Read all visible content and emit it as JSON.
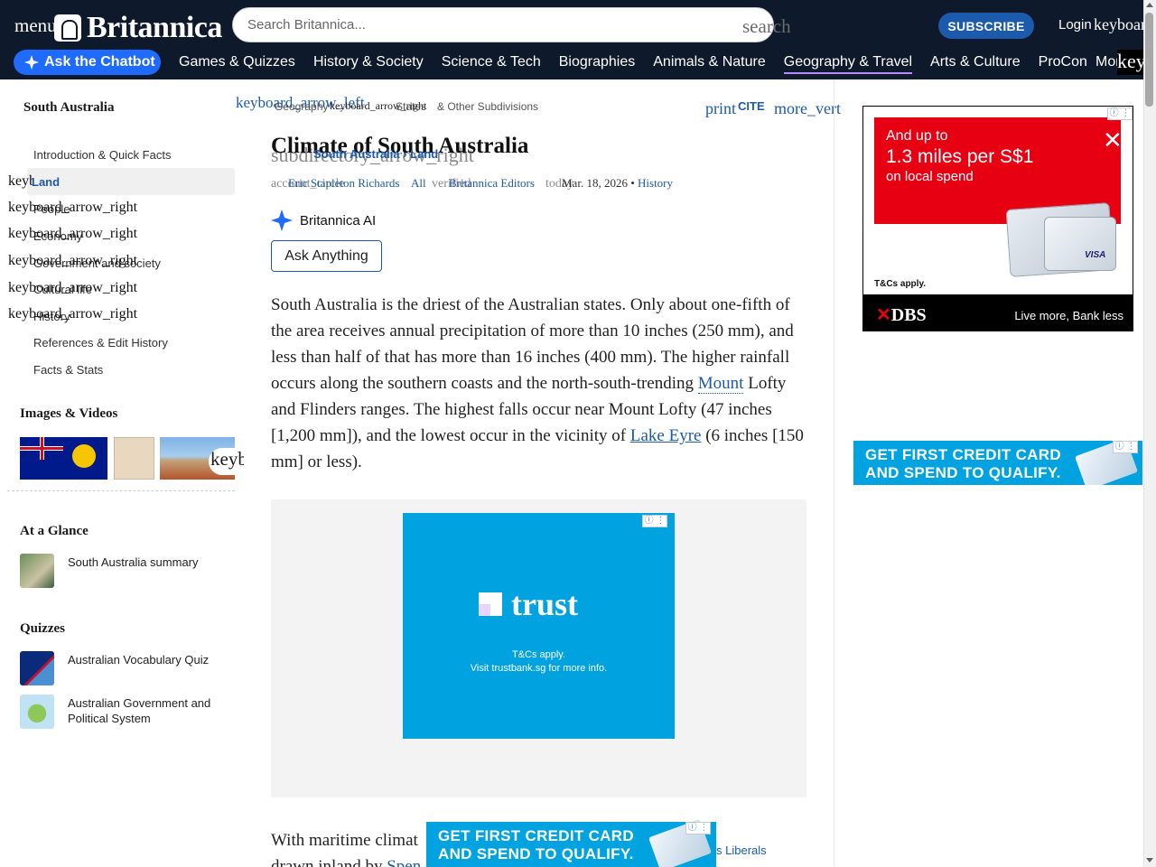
{
  "header": {
    "menu_label": "menu",
    "logo_text": "Britannica",
    "search_placeholder": "Search Britannica...",
    "search_icon_text": "search",
    "subscribe_label": "SUBSCRIBE",
    "login_label": "Login",
    "login_icon_text": "keyboard_arrow_down",
    "chatbot_label": "Ask the Chatbot",
    "nav": [
      "Games & Quizzes",
      "History & Society",
      "Science & Tech",
      "Biographies",
      "Animals & Nature",
      "Geography & Travel",
      "Arts & Culture",
      "ProCon"
    ],
    "nav_more": "More",
    "nav_more_icon_text": "keyboard_arrow_down",
    "active_nav": "Geography & Travel"
  },
  "sidebar": {
    "title": "South Australia",
    "toc": {
      "intro": "Introduction & Quick Facts",
      "land": "Land",
      "land_icon_text": "keyboard_arrow_down",
      "people": "People",
      "economy": "Economy",
      "government": "Government and society",
      "cultural": "Cultural life",
      "history": "History",
      "references": "References & Edit History",
      "facts": "Facts & Stats",
      "expand_icon_text": "keyboard_arrow_right"
    },
    "images_title": "Images & Videos",
    "images_next_icon_text": "keyboard_arrow_right",
    "glance_title": "At a Glance",
    "glance_item": "South Australia summary",
    "quizzes_title": "Quizzes",
    "quiz1": "Australian Vocabulary Quiz",
    "quiz2": "Australian Government and Political System"
  },
  "article": {
    "back_icon_text": "keyboard_arrow_left",
    "breadcrumb_start": "Geography",
    "breadcrumb_mid": "keyboard_arrow_right",
    "breadcrumb_states": "States",
    "breadcrumb_tail": "& Other Subdivisions",
    "print_text": "print",
    "cite_label": "CITE",
    "more_text": "more_vert",
    "title": "Climate of South Australia",
    "subdir_text": "subdirectory_arrow_right",
    "subdir_parent": "South Australia",
    "subdir_child": "Land",
    "meta_bg_text": "account_circle",
    "meta_author": "Eric Stapleton Richards",
    "meta_all": "All",
    "meta_verified_text": "verified",
    "meta_editors": "Britannica Editors",
    "meta_today_text": "today",
    "meta_date": "Mar. 18, 2026",
    "meta_history": "History",
    "ai_label": "Britannica AI",
    "ask_label": "Ask Anything",
    "p1_a": "South Australia is the driest of the Australian states. Only about one-fifth of the area receives annual precipitation of more than 10 inches (250 mm), and less than half of that has more than 16 inches (400 mm). The higher rainfall occurs along the southern coasts and the north-south-trending ",
    "p1_link1": "Mount",
    "p1_b": " Lofty and Flinders ranges. The highest falls occur near Mount Lofty (47 inches [1,200 mm]), and the lowest occur in the vicinity of ",
    "p1_link2": "Lake Eyre",
    "p1_c": " (6 inches [150 mm] or less).",
    "p2_start": "With maritime climat",
    "p2_line2": "drawn inland by ",
    "p2_link": "Spen",
    "peek_text": "s Liberals"
  },
  "ads": {
    "trust_brand": "trust",
    "trust_fine1": "T&Cs apply.",
    "trust_fine2": "Visit trustbank.sg for more info.",
    "cc_line1": "GET FIRST CREDIT CARD",
    "cc_line2": "AND SPEND TO QUALIFY.",
    "card_brand": "trust",
    "dbs_line1": "And up to",
    "dbs_line2": "1.3 miles per S$1",
    "dbs_line3": "on local spend",
    "dbs_visa": "VISA",
    "dbs_tc": "T&Cs apply.",
    "dbs_logo_x": "✕",
    "dbs_logo": "DBS",
    "dbs_tag": "Live more, Bank less",
    "adchoice": "ⓘ ⋮"
  }
}
